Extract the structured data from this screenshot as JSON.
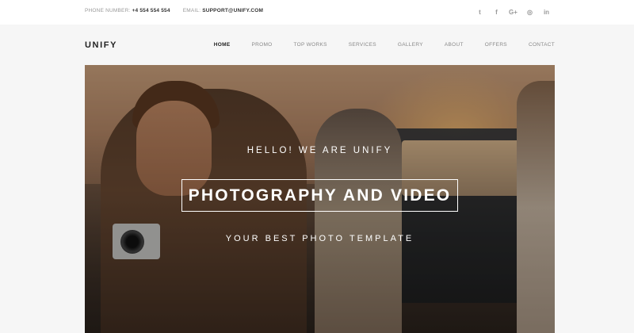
{
  "topbar": {
    "phone_label": "PHONE NUMBER:",
    "phone_value": "+4 554 554 554",
    "email_label": "EMAIL:",
    "email_value": "SUPPORT@UNIFY.COM",
    "social": [
      {
        "name": "twitter",
        "glyph": "t"
      },
      {
        "name": "facebook",
        "glyph": "f"
      },
      {
        "name": "google-plus",
        "glyph": "G+"
      },
      {
        "name": "instagram",
        "glyph": "◎"
      },
      {
        "name": "linkedin",
        "glyph": "in"
      }
    ]
  },
  "header": {
    "logo": "UNIFY",
    "nav": [
      "HOME",
      "PROMO",
      "TOP WORKS",
      "SERVICES",
      "GALLERY",
      "ABOUT",
      "OFFERS",
      "CONTACT"
    ],
    "active": "HOME"
  },
  "hero": {
    "tagline": "HELLO! WE ARE UNIFY",
    "title": "PHOTOGRAPHY AND VIDEO",
    "subtitle": "YOUR BEST PHOTO TEMPLATE"
  }
}
